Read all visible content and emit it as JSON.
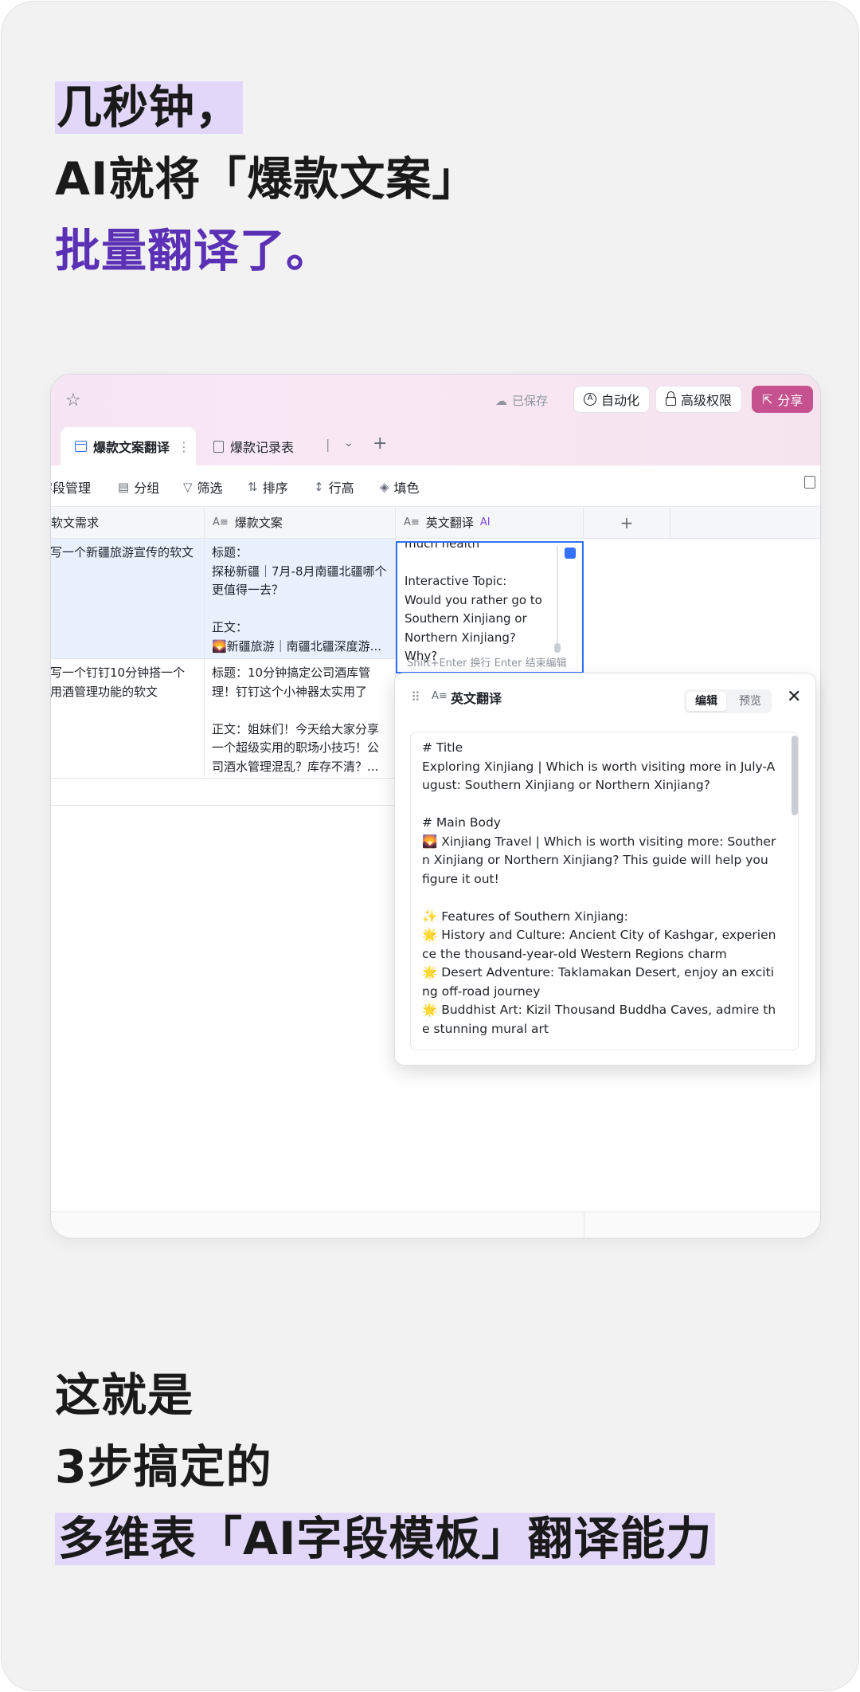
{
  "headline": {
    "line1": "几秒钟，",
    "line2": "AI就将「爆款文案」",
    "line3": "批量翻译了。"
  },
  "bottom": {
    "line1": "这就是",
    "line2": "3步搞定的",
    "line3": "多维表「AI字段模板」翻译能力"
  },
  "app": {
    "topbar": {
      "saved": "已保存",
      "automation": "自动化",
      "advanced_permissions": "高级权限",
      "share": "分享"
    },
    "tabs": [
      {
        "label": "爆款文案翻译"
      },
      {
        "label": "爆款记录表"
      }
    ],
    "toolbar": {
      "field_manage": "字段管理",
      "group": "分组",
      "filter": "筛选",
      "sort": "排序",
      "row_height": "行高",
      "fill": "填色"
    },
    "columns": {
      "c1": "软文需求",
      "c2": "爆款文案",
      "c3": "英文翻译",
      "c3_tag": "AI"
    },
    "rows": [
      {
        "req": "写一个新疆旅游宣传的软文",
        "copy": "标题：\n探秘新疆｜7月-8月南疆北疆哪个更值得一去？\n\n正文：\n🌄新疆旅游｜南疆北疆深度游..."
      },
      {
        "req": "写一个钉钉10分钟搭一个用酒管理功能的软文",
        "copy": "标题：10分钟搞定公司酒库管理！钉钉这个小神器太实用了\n\n正文：姐妹们！今天给大家分享一个超级实用的职场小技巧！公司酒水管理混乱？库存不清？..."
      }
    ],
    "edit_cell": {
      "text": "much health\n\nInteractive Topic:\nWould you rather go to Southern Xinjiang or Northern Xinjiang? Why?",
      "hint": "Shift+Enter 换行 Enter 结束编辑"
    },
    "panel": {
      "title": "英文翻译",
      "tab_edit": "编辑",
      "tab_preview": "预览",
      "content": "# Title\nExploring Xinjiang | Which is worth visiting more in July-August: Southern Xinjiang or Northern Xinjiang?\n\n# Main Body\n🌄 Xinjiang Travel | Which is worth visiting more: Southern Xinjiang or Northern Xinjiang? This guide will help you figure it out!\n\n✨ Features of Southern Xinjiang:\n🌟 History and Culture: Ancient City of Kashgar, experience the thousand-year-old Western Regions charm\n🌟 Desert Adventure: Taklamakan Desert, enjoy an exciting off-road journey\n🌟 Buddhist Art: Kizil Thousand Buddha Caves, admire the stunning mural art"
    }
  }
}
